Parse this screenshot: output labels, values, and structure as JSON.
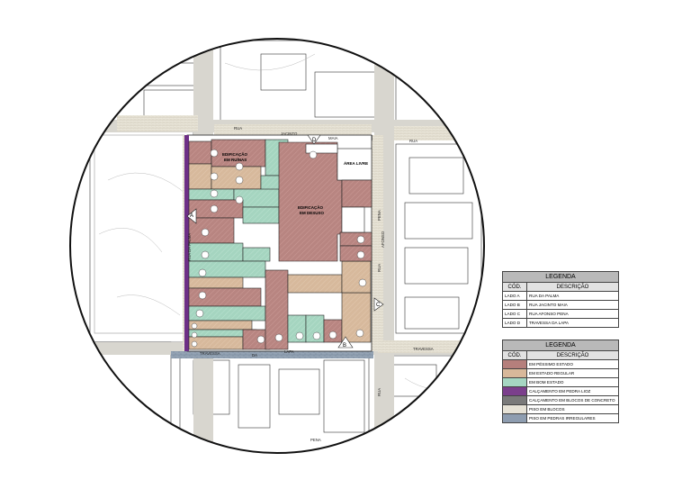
{
  "map": {
    "streets": {
      "rua_top_left": "RUA",
      "jacinto": "JACINTO",
      "maia": "MAIA",
      "rua_top_right": "RUA",
      "rua_left": "RUA DA PALMA",
      "rua_right_1": "RUA",
      "rua_right_2": "AFONSO",
      "rua_right_3": "PENA",
      "travessa_left": "TRAVESSA",
      "da": "DA",
      "lapa": "LAPA",
      "travessa_right": "TRAVESSA",
      "rua_bottom": "RUA",
      "pena_bottom": "PENA"
    },
    "markers": [
      "A",
      "B",
      "C",
      "D"
    ],
    "areas": {
      "ruinas_1": "EDIFICAÇÃO",
      "ruinas_2": "EM RUÍNAS",
      "desuso_1": "EDIFICAÇÃO",
      "desuso_2": "EM DESUSO",
      "livre": "ÁREA LIVRE"
    }
  },
  "legend1": {
    "title": "LEGENDA",
    "col_code": "CÓD.",
    "col_desc": "DESCRIÇÃO",
    "rows": [
      {
        "code": "LADO A",
        "desc": "RUA DA PALMA"
      },
      {
        "code": "LADO B",
        "desc": "RUA JACINTO MAIA"
      },
      {
        "code": "LADO C",
        "desc": "RUA AFONSO PENA"
      },
      {
        "code": "LADO D",
        "desc": "TRAVESSA DA LAPA"
      }
    ]
  },
  "legend2": {
    "title": "LEGENDA",
    "col_code": "CÓD.",
    "col_desc": "DESCRIÇÃO",
    "rows": [
      {
        "desc": "EM PÉSSIMO ESTADO",
        "color": "#b57f7c"
      },
      {
        "desc": "EM ESTADO REGULAR",
        "color": "#d8b89a"
      },
      {
        "desc": "EM BOM ESTADO",
        "color": "#a6d6c2"
      },
      {
        "desc": "CALÇAMENTO EM PEDRA LIOZ",
        "color": "#7b3f8c"
      },
      {
        "desc": "CALÇAMENTO EM BLOCOS DE CONCRETO",
        "color": "#7a7a7a"
      },
      {
        "desc": "PISO EM BLOCOS",
        "color": "#e6e2d6"
      },
      {
        "desc": "PISO EM PEDRAS IRREGULARES",
        "color": "#8e9db0"
      }
    ]
  }
}
